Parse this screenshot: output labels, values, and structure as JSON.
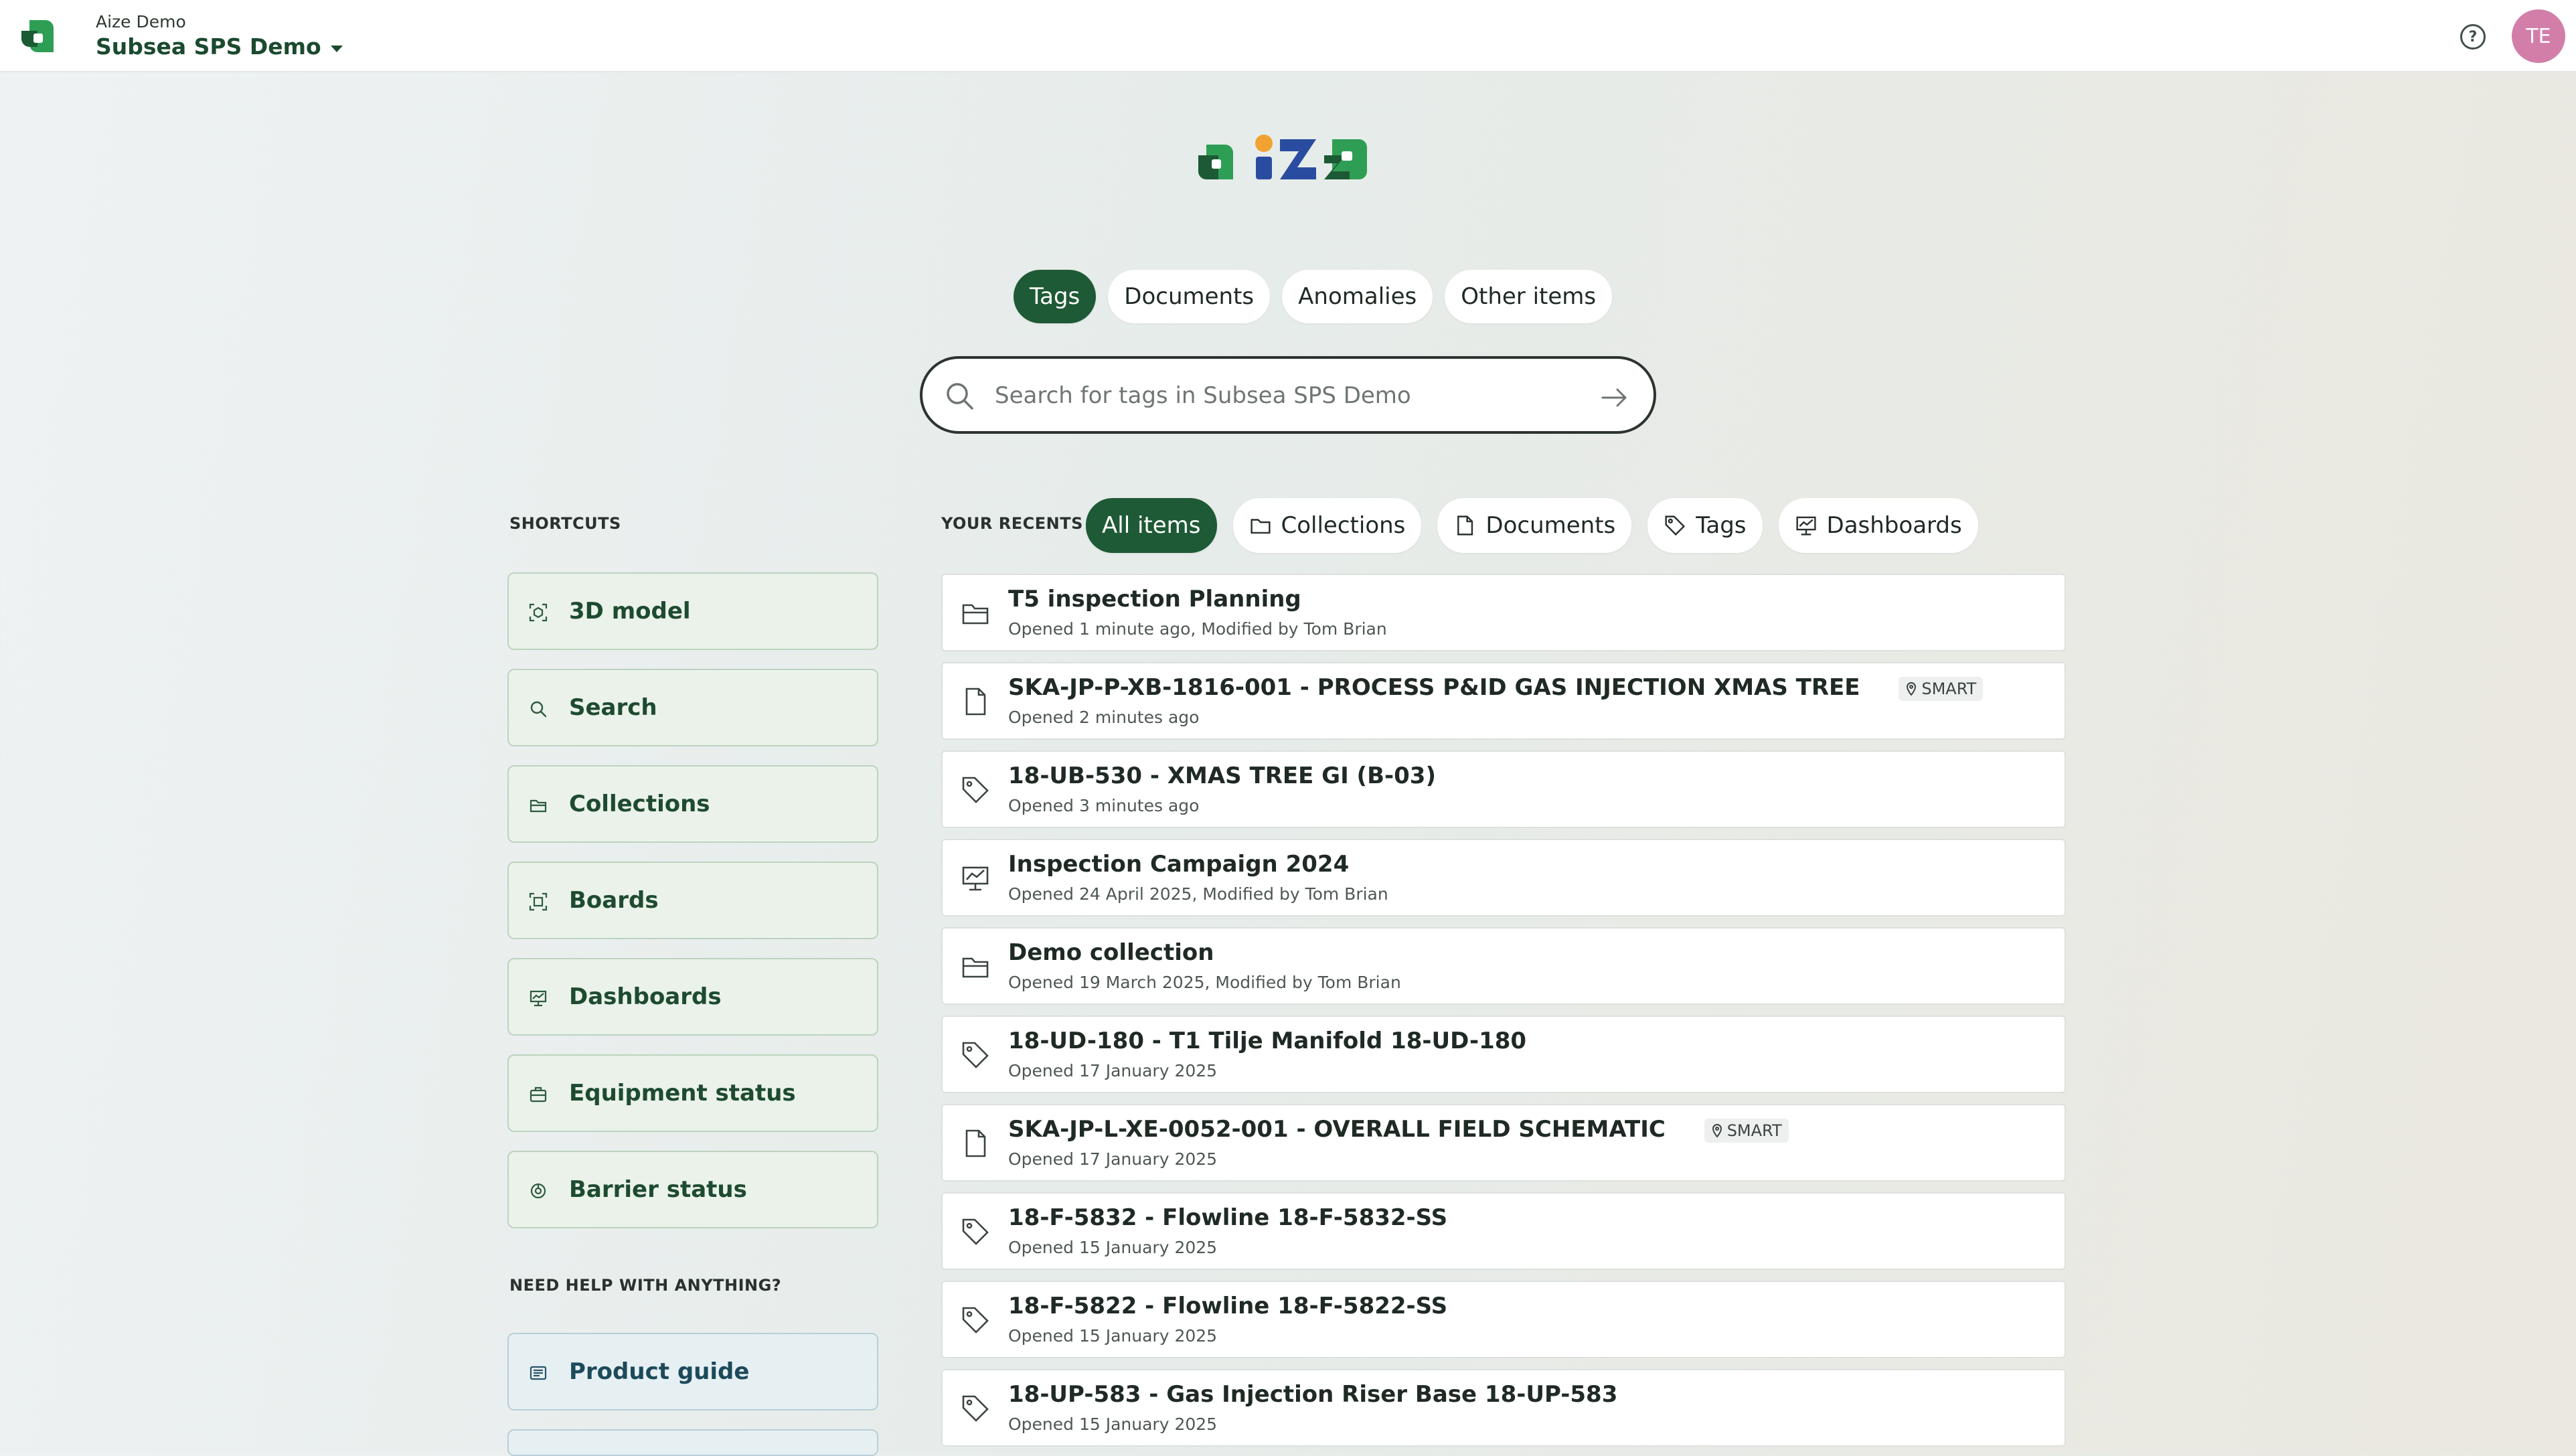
{
  "header": {
    "org_name": "Aize Demo",
    "project_name": "Subsea SPS Demo",
    "help_icon": "question-circle-icon",
    "avatar_initials": "TE",
    "avatar_color": "#d27ea8"
  },
  "scope_tabs": {
    "items": [
      {
        "label": "Tags",
        "active": true
      },
      {
        "label": "Documents",
        "active": false
      },
      {
        "label": "Anomalies",
        "active": false
      },
      {
        "label": "Other items",
        "active": false
      }
    ]
  },
  "search": {
    "placeholder": "Search for tags in Subsea SPS Demo",
    "value": ""
  },
  "shortcuts": {
    "title": "SHORTCUTS",
    "items": [
      {
        "label": "3D model",
        "icon": "cube-scan-icon"
      },
      {
        "label": "Search",
        "icon": "search-icon"
      },
      {
        "label": "Collections",
        "icon": "folder-icon"
      },
      {
        "label": "Boards",
        "icon": "board-icon"
      },
      {
        "label": "Dashboards",
        "icon": "dashboard-icon"
      },
      {
        "label": "Equipment status",
        "icon": "equipment-icon"
      },
      {
        "label": "Barrier status",
        "icon": "barrier-icon"
      }
    ]
  },
  "help": {
    "title": "NEED HELP WITH ANYTHING?",
    "items": [
      {
        "label": "Product guide",
        "icon": "guide-icon"
      }
    ]
  },
  "recents": {
    "title": "YOUR RECENTS",
    "filters": [
      {
        "label": "All items",
        "active": true,
        "icon": ""
      },
      {
        "label": "Collections",
        "active": false,
        "icon": "folder-icon"
      },
      {
        "label": "Documents",
        "active": false,
        "icon": "document-icon"
      },
      {
        "label": "Tags",
        "active": false,
        "icon": "tag-icon"
      },
      {
        "label": "Dashboards",
        "active": false,
        "icon": "dashboard-icon"
      }
    ],
    "items": [
      {
        "type": "folder",
        "title": "T5 inspection Planning",
        "subtitle": "Opened 1 minute ago, Modified by Tom Brian"
      },
      {
        "type": "document",
        "title": "SKA-JP-P-XB-1816-001 - PROCESS P&ID GAS INJECTION XMAS TREE",
        "badge": "SMART",
        "subtitle": "Opened 2 minutes ago"
      },
      {
        "type": "tag",
        "title": "18-UB-530 - XMAS TREE GI (B-03)",
        "subtitle": "Opened 3 minutes ago"
      },
      {
        "type": "dashboard",
        "title": "Inspection Campaign 2024",
        "subtitle": "Opened 24 April 2025, Modified by Tom Brian"
      },
      {
        "type": "folder",
        "title": "Demo collection",
        "subtitle": "Opened 19 March 2025, Modified by Tom Brian"
      },
      {
        "type": "tag",
        "title": "18-UD-180 - T1 Tilje Manifold 18-UD-180",
        "subtitle": "Opened 17 January 2025"
      },
      {
        "type": "document",
        "title": "SKA-JP-L-XE-0052-001 - OVERALL FIELD SCHEMATIC",
        "badge": "SMART",
        "subtitle": "Opened 17 January 2025"
      },
      {
        "type": "tag",
        "title": "18-F-5832 - Flowline 18-F-5832-SS",
        "subtitle": "Opened 15 January 2025"
      },
      {
        "type": "tag",
        "title": "18-F-5822 - Flowline 18-F-5822-SS",
        "subtitle": "Opened 15 January 2025"
      },
      {
        "type": "tag",
        "title": "18-UP-583 - Gas Injection Riser Base 18-UP-583",
        "subtitle": "Opened 15 January 2025"
      }
    ]
  },
  "colors": {
    "brand_green": "#1e5a35",
    "shortcut_bg": "#eaf2ea",
    "help_bg": "#e6f0f3"
  }
}
